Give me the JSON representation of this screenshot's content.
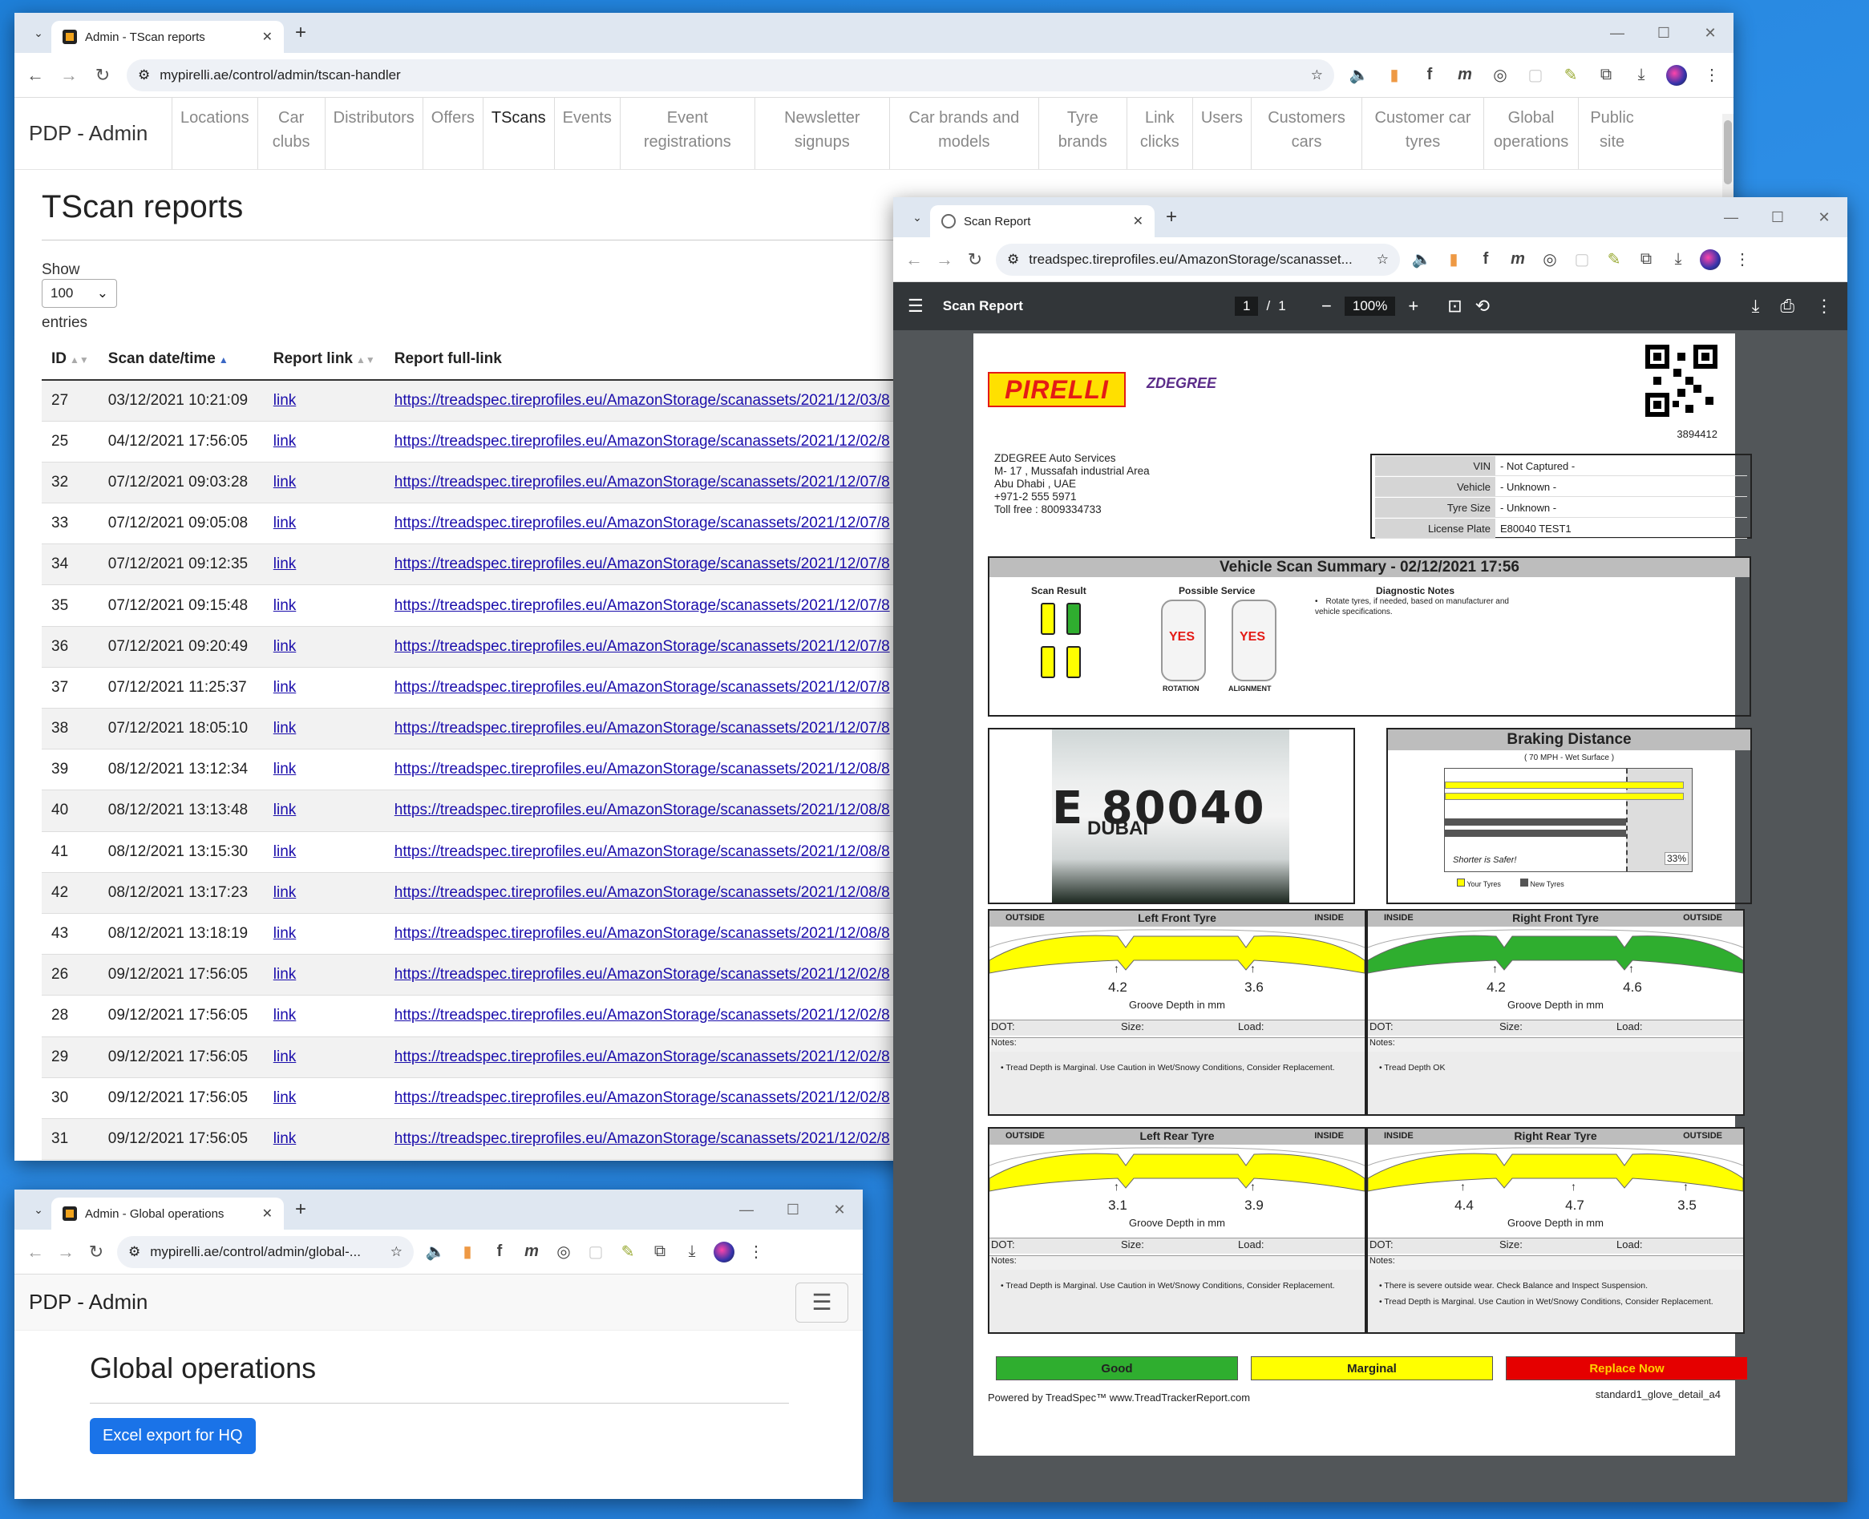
{
  "main_window": {
    "tab_title": "Admin - TScan reports",
    "url": "mypirelli.ae/control/admin/tscan-handler",
    "brand": "PDP - Admin",
    "nav": [
      "Locations",
      "Car clubs",
      "Distributors",
      "Offers",
      "TScans",
      "Events",
      "Event registrations",
      "Newsletter signups",
      "Car brands and models",
      "Tyre brands",
      "Link clicks",
      "Users",
      "Customers cars",
      "Customer car tyres",
      "Global operations",
      "Public site"
    ],
    "active_nav": "TScans",
    "title": "TScan reports",
    "show_label": "Show",
    "show_value": "100",
    "entries_label": "entries",
    "columns": [
      "ID",
      "Scan date/time",
      "Report link",
      "Report full-link"
    ],
    "rows": [
      {
        "id": "27",
        "date": "03/12/2021 10:21:09",
        "link": "link",
        "full": "https://treadspec.tireprofiles.eu/AmazonStorage/scanassets/2021/12/03/8"
      },
      {
        "id": "25",
        "date": "04/12/2021 17:56:05",
        "link": "link",
        "full": "https://treadspec.tireprofiles.eu/AmazonStorage/scanassets/2021/12/02/8"
      },
      {
        "id": "32",
        "date": "07/12/2021 09:03:28",
        "link": "link",
        "full": "https://treadspec.tireprofiles.eu/AmazonStorage/scanassets/2021/12/07/8"
      },
      {
        "id": "33",
        "date": "07/12/2021 09:05:08",
        "link": "link",
        "full": "https://treadspec.tireprofiles.eu/AmazonStorage/scanassets/2021/12/07/8"
      },
      {
        "id": "34",
        "date": "07/12/2021 09:12:35",
        "link": "link",
        "full": "https://treadspec.tireprofiles.eu/AmazonStorage/scanassets/2021/12/07/8"
      },
      {
        "id": "35",
        "date": "07/12/2021 09:15:48",
        "link": "link",
        "full": "https://treadspec.tireprofiles.eu/AmazonStorage/scanassets/2021/12/07/8"
      },
      {
        "id": "36",
        "date": "07/12/2021 09:20:49",
        "link": "link",
        "full": "https://treadspec.tireprofiles.eu/AmazonStorage/scanassets/2021/12/07/8"
      },
      {
        "id": "37",
        "date": "07/12/2021 11:25:37",
        "link": "link",
        "full": "https://treadspec.tireprofiles.eu/AmazonStorage/scanassets/2021/12/07/8"
      },
      {
        "id": "38",
        "date": "07/12/2021 18:05:10",
        "link": "link",
        "full": "https://treadspec.tireprofiles.eu/AmazonStorage/scanassets/2021/12/07/8"
      },
      {
        "id": "39",
        "date": "08/12/2021 13:12:34",
        "link": "link",
        "full": "https://treadspec.tireprofiles.eu/AmazonStorage/scanassets/2021/12/08/8"
      },
      {
        "id": "40",
        "date": "08/12/2021 13:13:48",
        "link": "link",
        "full": "https://treadspec.tireprofiles.eu/AmazonStorage/scanassets/2021/12/08/8"
      },
      {
        "id": "41",
        "date": "08/12/2021 13:15:30",
        "link": "link",
        "full": "https://treadspec.tireprofiles.eu/AmazonStorage/scanassets/2021/12/08/8"
      },
      {
        "id": "42",
        "date": "08/12/2021 13:17:23",
        "link": "link",
        "full": "https://treadspec.tireprofiles.eu/AmazonStorage/scanassets/2021/12/08/8"
      },
      {
        "id": "43",
        "date": "08/12/2021 13:18:19",
        "link": "link",
        "full": "https://treadspec.tireprofiles.eu/AmazonStorage/scanassets/2021/12/08/8"
      },
      {
        "id": "26",
        "date": "09/12/2021 17:56:05",
        "link": "link",
        "full": "https://treadspec.tireprofiles.eu/AmazonStorage/scanassets/2021/12/02/8"
      },
      {
        "id": "28",
        "date": "09/12/2021 17:56:05",
        "link": "link",
        "full": "https://treadspec.tireprofiles.eu/AmazonStorage/scanassets/2021/12/02/8"
      },
      {
        "id": "29",
        "date": "09/12/2021 17:56:05",
        "link": "link",
        "full": "https://treadspec.tireprofiles.eu/AmazonStorage/scanassets/2021/12/02/8"
      },
      {
        "id": "30",
        "date": "09/12/2021 17:56:05",
        "link": "link",
        "full": "https://treadspec.tireprofiles.eu/AmazonStorage/scanassets/2021/12/02/8"
      },
      {
        "id": "31",
        "date": "09/12/2021 17:56:05",
        "link": "link",
        "full": "https://treadspec.tireprofiles.eu/AmazonStorage/scanassets/2021/12/02/8"
      }
    ]
  },
  "global_window": {
    "tab_title": "Admin - Global operations",
    "url": "mypirelli.ae/control/admin/global-...",
    "brand": "PDP - Admin",
    "title": "Global operations",
    "button": "Excel export for HQ"
  },
  "pdf_window": {
    "tab_title": "Scan Report",
    "url": "treadspec.tireprofiles.eu/AmazonStorage/scanasset...",
    "viewer_title": "Scan Report",
    "page_current": "1",
    "page_total": "1",
    "zoom": "100%",
    "report": {
      "logo": "PIRELLI",
      "partner_logo": "ZDEGREE",
      "report_number": "3894412",
      "address": [
        "ZDEGREE Auto Services",
        "M- 17 , Mussafah industrial Area",
        "Abu Dhabi , UAE",
        "+971-2 555 5971",
        "Toll free : 8009334733"
      ],
      "vehicle_info": [
        {
          "k": "VIN",
          "v": "- Not Captured -"
        },
        {
          "k": "Vehicle",
          "v": "- Unknown -"
        },
        {
          "k": "Tyre Size",
          "v": "- Unknown -"
        },
        {
          "k": "License Plate",
          "v": "E80040 TEST1"
        }
      ],
      "summary_title": "Vehicle Scan Summary - 02/12/2021 17:56",
      "scan_result_label": "Scan Result",
      "possible_service_label": "Possible Service",
      "diagnostic_label": "Diagnostic Notes",
      "diagnostic_note": "Rotate tyres, if needed, based on manufacturer and vehicle specifications.",
      "yes": "YES",
      "rotation": "ROTATION",
      "alignment": "ALIGNMENT",
      "plate_text": "E 80040",
      "plate_city": "DUBAI",
      "braking_title": "Braking Distance",
      "braking_sub": "( 70 MPH - Wet Surface )",
      "shorter_safer": "Shorter is Safer!",
      "braking_pct": "33%",
      "your_tyres": "Your Tyres",
      "new_tyres": "New Tyres",
      "groove_label": "Groove Depth in mm",
      "dot": "DOT:",
      "size": "Size:",
      "load": "Load:",
      "notes_label": "Notes:",
      "outside": "OUTSIDE",
      "inside": "INSIDE",
      "tyres": [
        {
          "name": "Left Front Tyre",
          "d1": "4.2",
          "d2": "3.6",
          "d3": "",
          "note1": "Tread Depth is Marginal. Use Caution in Wet/Snowy Conditions, Consider Replacement.",
          "note2": ""
        },
        {
          "name": "Right Front Tyre",
          "d1": "4.2",
          "d2": "4.6",
          "d3": "",
          "note1": "Tread Depth OK",
          "note2": ""
        },
        {
          "name": "Left Rear Tyre",
          "d1": "3.1",
          "d2": "3.9",
          "d3": "",
          "note1": "Tread Depth is Marginal. Use Caution in Wet/Snowy Conditions, Consider Replacement.",
          "note2": ""
        },
        {
          "name": "Right Rear Tyre",
          "d1": "4.4",
          "d2": "4.7",
          "d3": "3.5",
          "note1": "There is severe outside wear. Check Balance and Inspect Suspension.",
          "note2": "Tread Depth is Marginal. Use Caution in Wet/Snowy Conditions, Consider Replacement."
        }
      ],
      "legend": {
        "good": "Good",
        "marginal": "Marginal",
        "replace": "Replace Now"
      },
      "powered": "Powered by TreadSpec™ www.TreadTrackerReport.com",
      "template": "standard1_glove_detail_a4"
    }
  },
  "colors": {
    "good": "#2fae2f",
    "marginal": "#ffff00",
    "replace": "#e50000",
    "link": "#1a0dab",
    "primary": "#1a73e8"
  }
}
